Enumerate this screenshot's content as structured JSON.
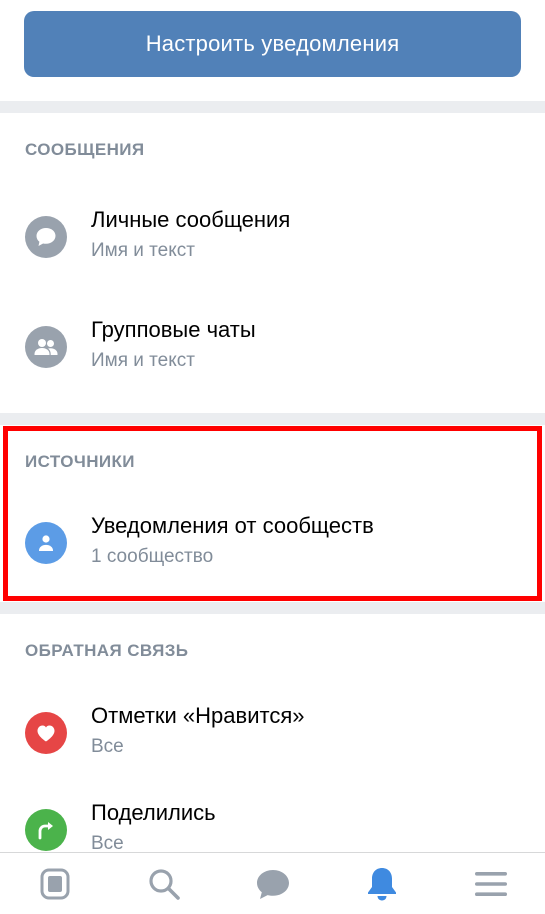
{
  "setup_button": {
    "label": "Настроить уведомления"
  },
  "sections": {
    "messages": {
      "header": "СООБЩЕНИЯ",
      "items": [
        {
          "title": "Личные сообщения",
          "subtitle": "Имя и текст",
          "icon": "chat-bubble-icon",
          "color": "#99a2ad"
        },
        {
          "title": "Групповые чаты",
          "subtitle": "Имя и текст",
          "icon": "group-icon",
          "color": "#99a2ad"
        }
      ]
    },
    "sources": {
      "header": "ИСТОЧНИКИ",
      "items": [
        {
          "title": "Уведомления от сообществ",
          "subtitle": "1 сообщество",
          "icon": "user-icon",
          "color": "#5c9ce6"
        }
      ]
    },
    "feedback": {
      "header": "ОБРАТНАЯ СВЯЗЬ",
      "items": [
        {
          "title": "Отметки «Нравится»",
          "subtitle": "Все",
          "icon": "heart-icon",
          "color": "#e64646"
        },
        {
          "title": "Поделились",
          "subtitle": "Все",
          "icon": "share-icon",
          "color": "#4bb34b"
        }
      ]
    }
  },
  "tabbar": {
    "tabs": [
      {
        "icon": "news-icon",
        "active": false
      },
      {
        "icon": "search-icon",
        "active": false
      },
      {
        "icon": "messages-icon",
        "active": false
      },
      {
        "icon": "bell-icon",
        "active": true
      },
      {
        "icon": "menu-icon",
        "active": false
      }
    ],
    "colors": {
      "active": "#3f8ae0",
      "inactive": "#99a2ad"
    }
  },
  "highlight_color": "#ff0000"
}
